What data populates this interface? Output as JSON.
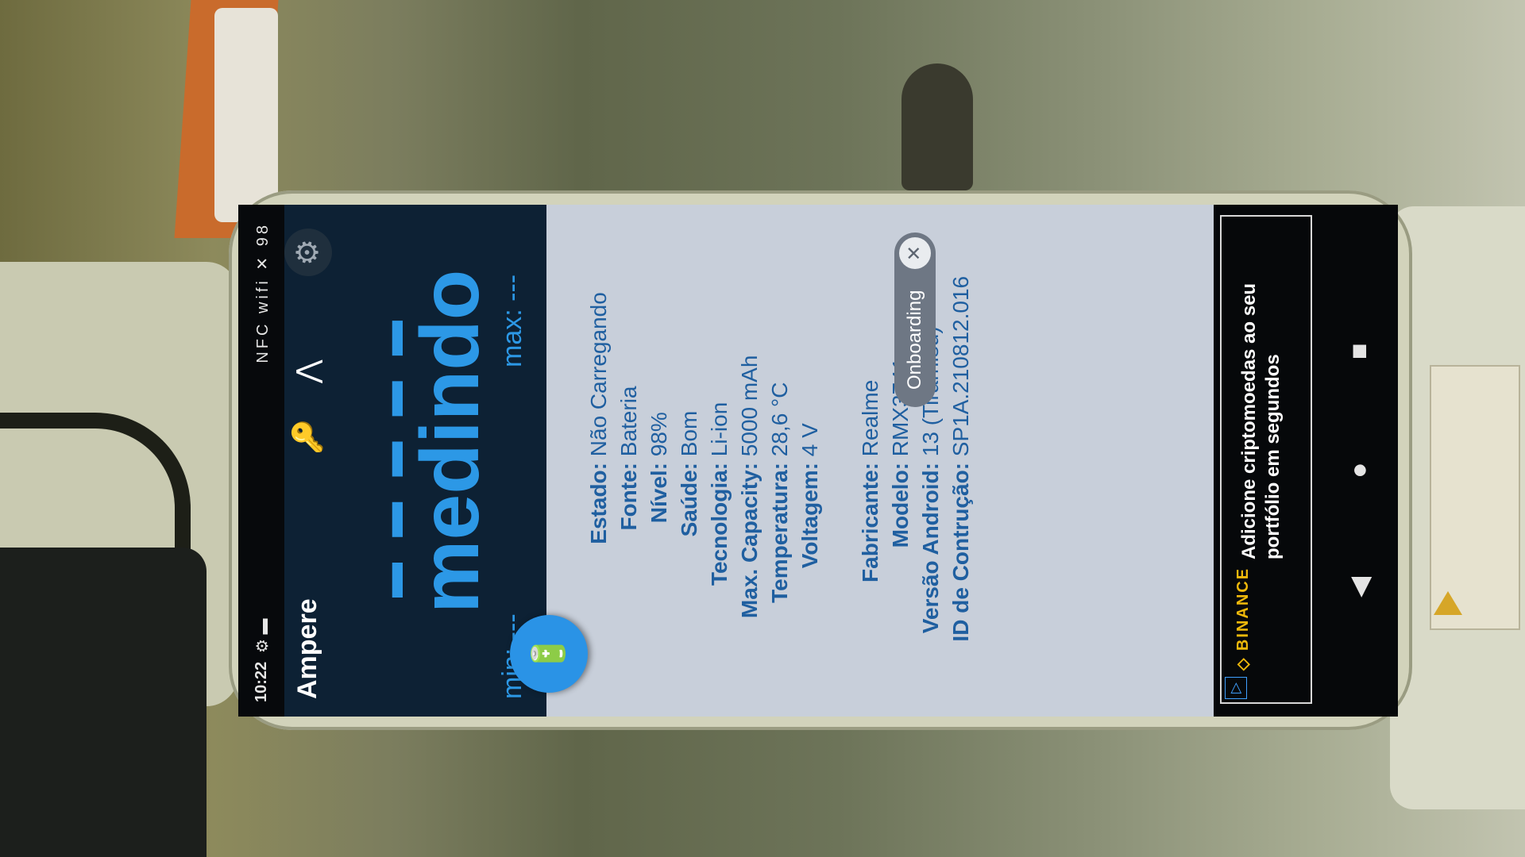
{
  "status_bar": {
    "time": "10:22",
    "left_icons": "⚙ ▬",
    "right_icons": "NFC wifi ✕ 98"
  },
  "header": {
    "app_title": "Ampere",
    "dashes": "▬ ▬ ▬ ▬ ▬",
    "status_word": "medindo",
    "min_label": "min: ---",
    "max_label": "max: ---"
  },
  "info_rows": [
    {
      "key": "Estado:",
      "value": "Não Carregando"
    },
    {
      "key": "Fonte:",
      "value": "Bateria"
    },
    {
      "key": "Nível:",
      "value": "98%"
    },
    {
      "key": "Saúde:",
      "value": "Bom"
    },
    {
      "key": "Tecnologia:",
      "value": "Li-ion"
    },
    {
      "key": "Max. Capacity:",
      "value": "5000 mAh"
    },
    {
      "key": "Temperatura:",
      "value": "28,6 °C"
    },
    {
      "key": "Voltagem:",
      "value": "4 V"
    },
    {
      "key": "Fabricante:",
      "value": "Realme"
    },
    {
      "key": "Modelo:",
      "value": "RMX3741"
    },
    {
      "key": "Versão Android:",
      "value": "13 (Tiramisu)"
    },
    {
      "key": "ID de Contrução:",
      "value": "SP1A.210812.016"
    }
  ],
  "onboarding": {
    "label": "Onboarding",
    "close": "✕"
  },
  "ad": {
    "brand": "◇ BINANCE",
    "text": "Adicione criptomoedas ao seu portfólio em segundos",
    "info_icon": "▷"
  },
  "nav": {
    "back": "◀",
    "home": "●",
    "recent": "■"
  },
  "icons": {
    "fab": "🔋",
    "key": "🔑",
    "share": "⋀",
    "gear": "⚙"
  }
}
